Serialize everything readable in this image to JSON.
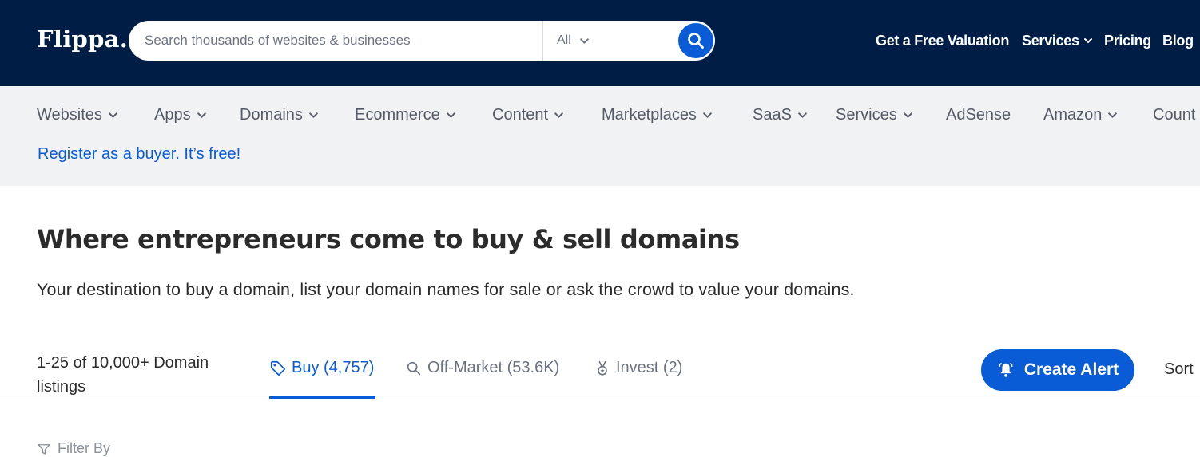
{
  "header": {
    "logo": "Flippa.",
    "search_placeholder": "Search thousands of websites & businesses",
    "search_category": "All",
    "nav": [
      {
        "label": "Get a Free Valuation"
      },
      {
        "label": "Services"
      },
      {
        "label": "Pricing"
      },
      {
        "label": "Blog"
      }
    ]
  },
  "categories": [
    {
      "label": "Websites"
    },
    {
      "label": "Apps"
    },
    {
      "label": "Domains"
    },
    {
      "label": "Ecommerce"
    },
    {
      "label": "Content"
    },
    {
      "label": "Marketplaces"
    },
    {
      "label": "SaaS"
    },
    {
      "label": "Services"
    },
    {
      "label": "AdSense"
    },
    {
      "label": "Amazon"
    },
    {
      "label": "Count"
    }
  ],
  "register_link": "Register as a buyer. It’s free!",
  "hero": {
    "title": "Where entrepreneurs come to buy & sell domains",
    "subtitle": "Your destination to buy a domain, list your domain names for sale or ask the crowd to value your domains."
  },
  "listings": {
    "count_text": "1-25 of 10,000+ Domain listings",
    "tabs": [
      {
        "label": "Buy (4,757)",
        "icon": "tag-icon"
      },
      {
        "label": "Off-Market (53.6K)",
        "icon": "search-icon"
      },
      {
        "label": "Invest (2)",
        "icon": "medal-icon"
      }
    ],
    "create_alert": "Create Alert",
    "sort_label": "Sort",
    "filter_label": "Filter By"
  },
  "colors": {
    "topbar": "#001e45",
    "accent": "#0a5bd6",
    "subbar": "#f1f2f4"
  }
}
